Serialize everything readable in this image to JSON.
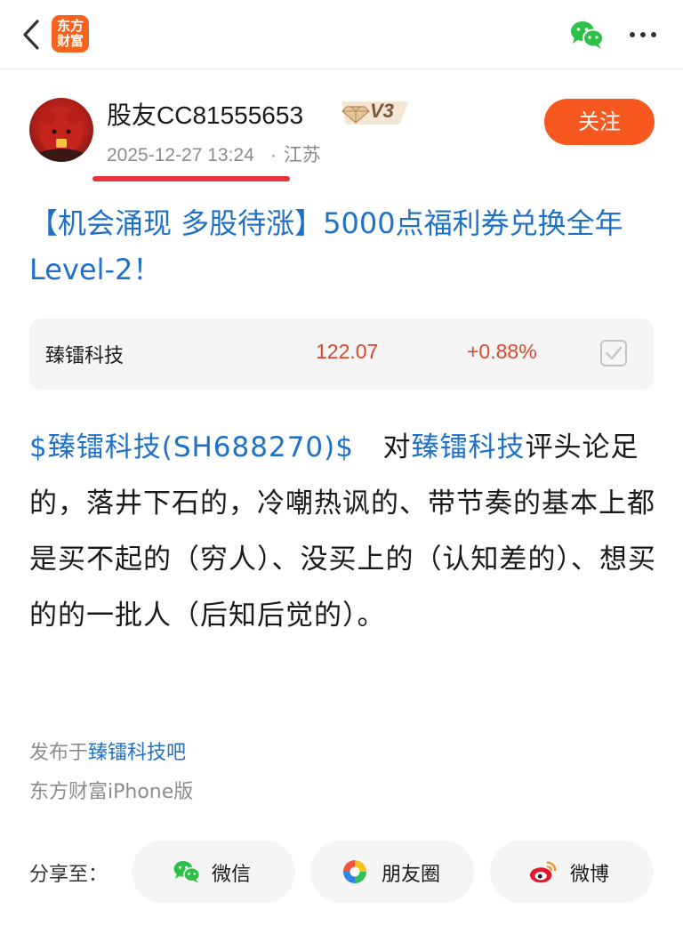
{
  "header": {
    "logo_line1": "东方",
    "logo_line2": "财富"
  },
  "author": {
    "name": "股友CC81555653",
    "level": "V3",
    "date": "2025-12-27 13:24",
    "location": "江苏",
    "follow_label": "关注"
  },
  "post": {
    "title": "【机会涌现 多股待涨】5000点福利券兑换全年Level-2！",
    "stock": {
      "name": "臻镭科技",
      "price": "122.07",
      "change": "+0.88%"
    },
    "body": {
      "tag_link": "$臻镭科技(SH688270)$",
      "intro": "对",
      "stock_link": "臻镭科技",
      "text": "评头论足的，落井下石的，冷嘲热讽的、带节奏的基本上都是买不起的（穷人）、没买上的（认知差的）、想买的的一批人（后知后觉的）。"
    },
    "published_prefix": "发布于",
    "published_bar": "臻镭科技吧",
    "client": "东方财富iPhone版"
  },
  "share": {
    "label": "分享至：",
    "wechat": "微信",
    "moments": "朋友圈",
    "weibo": "微博"
  },
  "colors": {
    "brand_orange": "#f7581f",
    "link_blue": "#1f71c8",
    "price_red": "#e0472d",
    "highlight_red": "#e8343f"
  }
}
